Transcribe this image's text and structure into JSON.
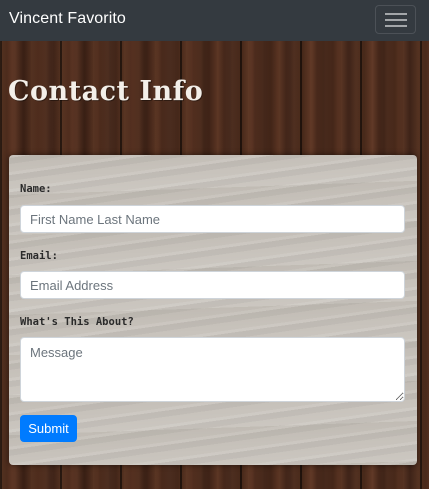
{
  "navbar": {
    "brand": "Vincent Favorito",
    "toggler_icon": "hamburger-menu-icon"
  },
  "page": {
    "title": "Contact Info"
  },
  "form": {
    "name_label": "Name:",
    "name_placeholder": "First Name Last Name",
    "email_label": "Email:",
    "email_placeholder": "Email Address",
    "message_label": "What's This About?",
    "message_placeholder": "Message",
    "submit_label": "Submit"
  },
  "colors": {
    "navbar_bg": "#343a40",
    "primary_button": "#007bff"
  }
}
